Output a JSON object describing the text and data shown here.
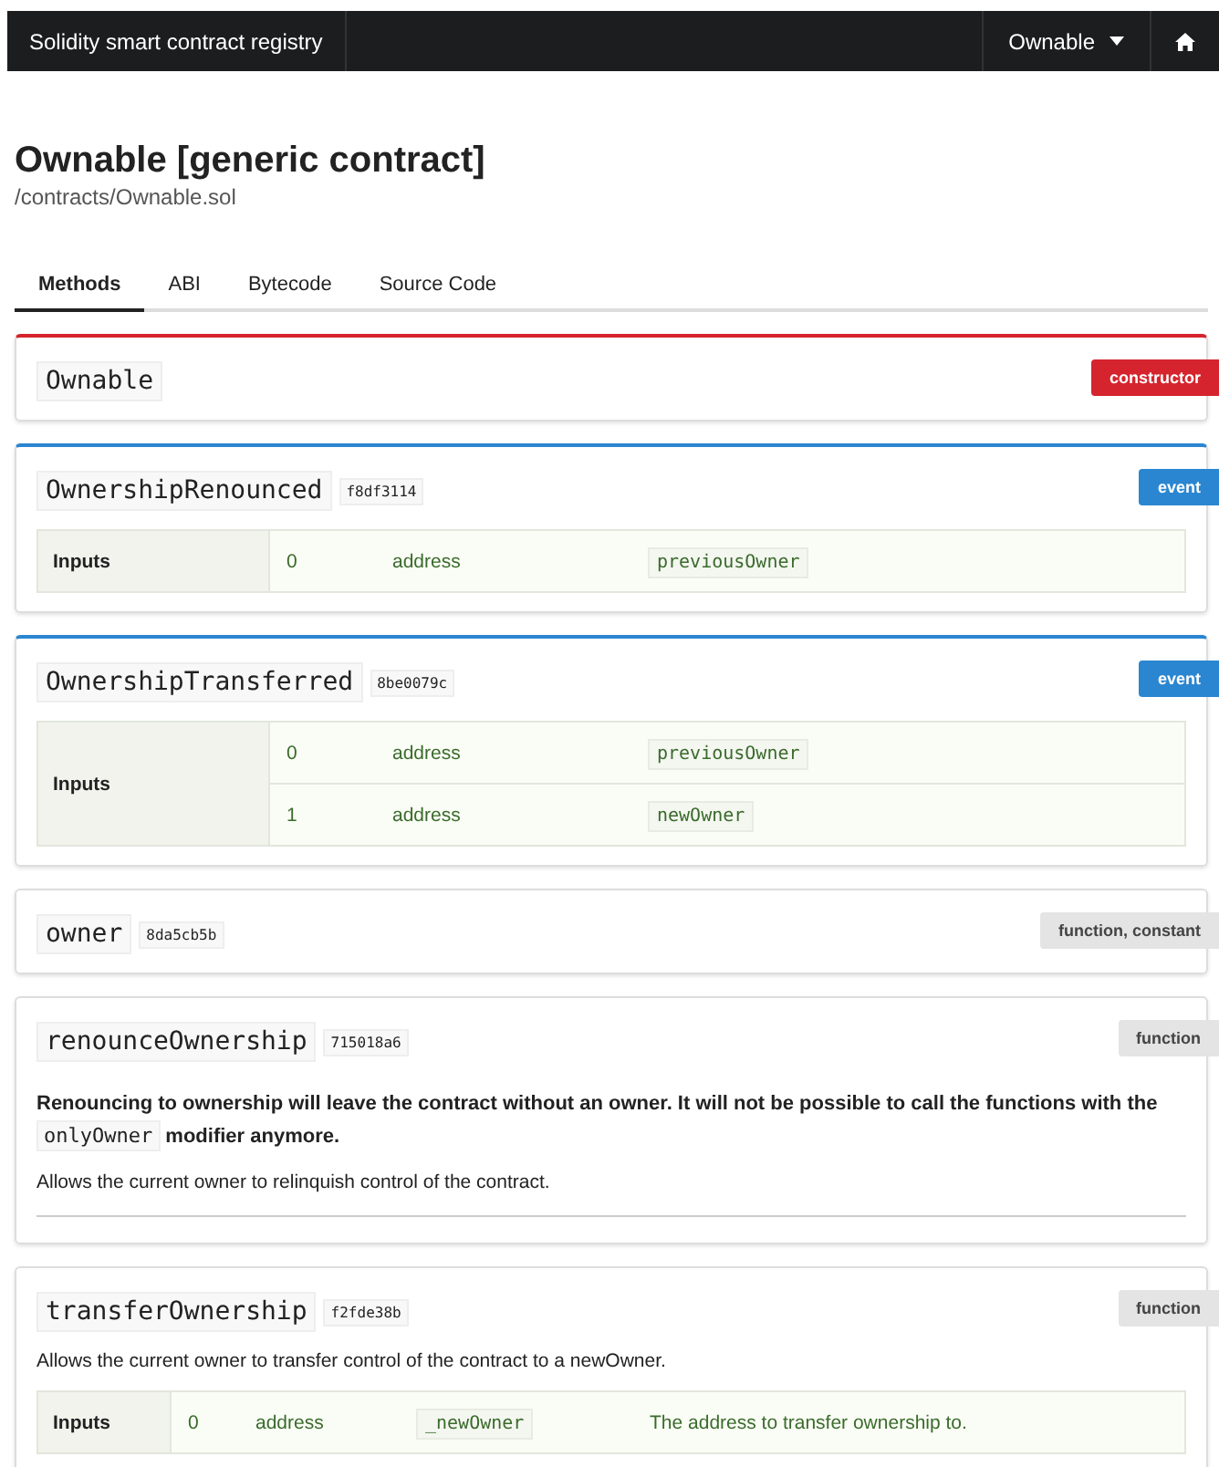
{
  "navbar": {
    "brand": "Solidity smart contract registry",
    "dropdown": "Ownable"
  },
  "page": {
    "title": "Ownable [generic contract]",
    "path": "/contracts/Ownable.sol"
  },
  "tabs": [
    {
      "label": "Methods",
      "selected": true
    },
    {
      "label": "ABI",
      "selected": false
    },
    {
      "label": "Bytecode",
      "selected": false
    },
    {
      "label": "Source Code",
      "selected": false
    }
  ],
  "methods": [
    {
      "kind": "constructor",
      "name": "Ownable",
      "badge": "constructor"
    },
    {
      "kind": "event",
      "name": "OwnershipRenounced",
      "selector": "f8df3114",
      "badge": "event",
      "inputs_label": "Inputs",
      "inputs": [
        {
          "index": "0",
          "type": "address",
          "name": "previousOwner"
        }
      ]
    },
    {
      "kind": "event",
      "name": "OwnershipTransferred",
      "selector": "8be0079c",
      "badge": "event",
      "inputs_label": "Inputs",
      "inputs": [
        {
          "index": "0",
          "type": "address",
          "name": "previousOwner"
        },
        {
          "index": "1",
          "type": "address",
          "name": "newOwner"
        }
      ]
    },
    {
      "kind": "function",
      "name": "owner",
      "selector": "8da5cb5b",
      "badge": "function, constant"
    },
    {
      "kind": "function",
      "name": "renounceOwnership",
      "selector": "715018a6",
      "badge": "function",
      "notice": [
        {
          "kind": "text",
          "text": "Renouncing to ownership will leave the contract without an owner. It will not be possible to call the functions with the"
        },
        {
          "kind": "code",
          "text": "onlyOwner"
        },
        {
          "kind": "text",
          "text": "modifier anymore."
        }
      ],
      "description": "Allows the current owner to relinquish control of the contract.",
      "divider": true
    },
    {
      "kind": "function",
      "name": "transferOwnership",
      "selector": "f2fde38b",
      "badge": "function",
      "description": "Allows the current owner to transfer control of the contract to a newOwner.",
      "inputs_label": "Inputs",
      "inputs": [
        {
          "index": "0",
          "type": "address",
          "name": "_newOwner",
          "description": "The address to transfer ownership to."
        }
      ]
    }
  ]
}
